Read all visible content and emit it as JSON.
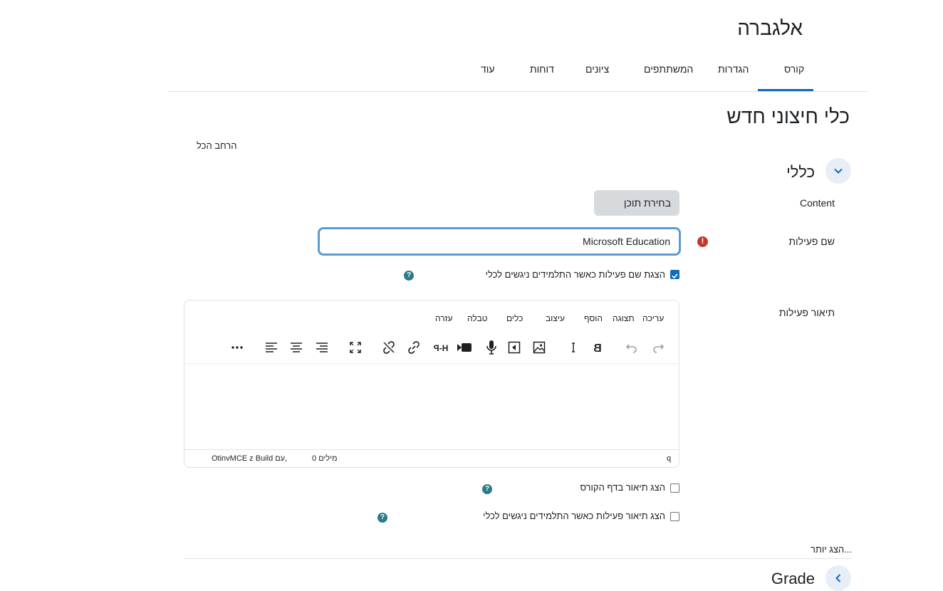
{
  "course": {
    "title": "אלגברה"
  },
  "nav": {
    "items": [
      "קורס",
      "הגדרות",
      "המשתתפים",
      "ציונים",
      "דוחות",
      "עוד"
    ],
    "active": "קורס"
  },
  "page": {
    "heading": "כלי חיצוני חדש",
    "expand_all": "הרחב הכל"
  },
  "section_general": {
    "title": "כללי",
    "content_label": "Content",
    "content_button": "בחירת תוכן",
    "activity_name_label": "שם פעילות",
    "activity_name_value": "Microsoft Education",
    "show_name_checkbox": "הצגת שם פעילות כאשר התלמידים ניגשים לכלי",
    "show_name_checked": true,
    "description_label": "תיאור פעילות",
    "show_desc_course_checkbox": "הצג תיאור בדף הקורס",
    "show_desc_course_checked": false,
    "show_desc_launch_checkbox": "הצג תיאור פעילות כאשר התלמידים ניגשים לכלי",
    "show_desc_launch_checked": false,
    "show_more": "הצג יותר..."
  },
  "editor": {
    "menu": [
      "עריכה",
      "תצוגה",
      "הוסף",
      "עיצוב",
      "כלים",
      "טבלה",
      "עזרה"
    ],
    "status_left": "OtinvMCE z Build עם,",
    "word_count": "0 מילים",
    "status_right": "q"
  },
  "section_grade": {
    "title": "Grade"
  },
  "icons": [
    "chevron-down-icon",
    "chevron-left-icon",
    "redo-icon",
    "undo-icon",
    "bold-icon",
    "italic-icon",
    "image-icon",
    "media-icon",
    "microphone-icon",
    "video-icon",
    "h5p-icon",
    "link-icon",
    "unlink-icon",
    "fullscreen-icon",
    "align-right-icon",
    "align-center-icon",
    "align-left-icon",
    "more-icon"
  ],
  "colors": {
    "accent": "#0f6cbf",
    "error": "#c0392b",
    "help": "#2b7b8a",
    "toggle_bg": "#e7eef8"
  }
}
